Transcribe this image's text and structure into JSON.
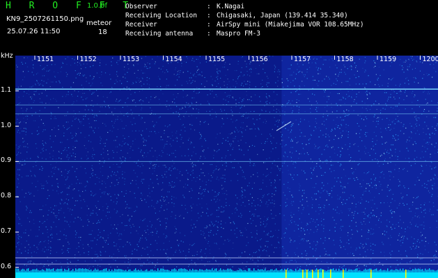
{
  "header": {
    "logo": "H R O F F T",
    "version": "1.0.0f",
    "filename": "KN9_2507261150.png",
    "datetime": "25.07.26 11:50",
    "meteor_label": "meteor",
    "meteor_count": "18",
    "meta": [
      {
        "key": "Observer",
        "sep": ":",
        "value": "K.Nagai"
      },
      {
        "key": "Receiving Location",
        "sep": ":",
        "value": "Chigasaki, Japan (139.414 35.340)"
      },
      {
        "key": "Receiver",
        "sep": ":",
        "value": "AirSpy mini (Miakejima VOR 108.65MHz)"
      },
      {
        "key": "Receiving antenna",
        "sep": ":",
        "value": "Maspro FM-3"
      }
    ]
  },
  "chart_data": {
    "type": "heatmap",
    "ylabel": "kHz",
    "x_ticks": [
      "1151",
      "1152",
      "1153",
      "1154",
      "1155",
      "1156",
      "1157",
      "1158",
      "1159",
      "1200"
    ],
    "y_ticks": [
      "1.1",
      "1.0",
      "0.9",
      "0.8",
      "0.7",
      "0.6"
    ],
    "y_range_khz": [
      0.57,
      1.2
    ],
    "x_range": [
      "11:50",
      "12:00"
    ],
    "horizontal_lines_khz": [
      1.105,
      1.06,
      1.035,
      0.9
    ],
    "colors": {
      "background": "#0a1a8a",
      "noise": "#2fa8ff",
      "line": "#7fdcff",
      "baseline": "#00e0ff",
      "marker": "#ffff00"
    }
  }
}
